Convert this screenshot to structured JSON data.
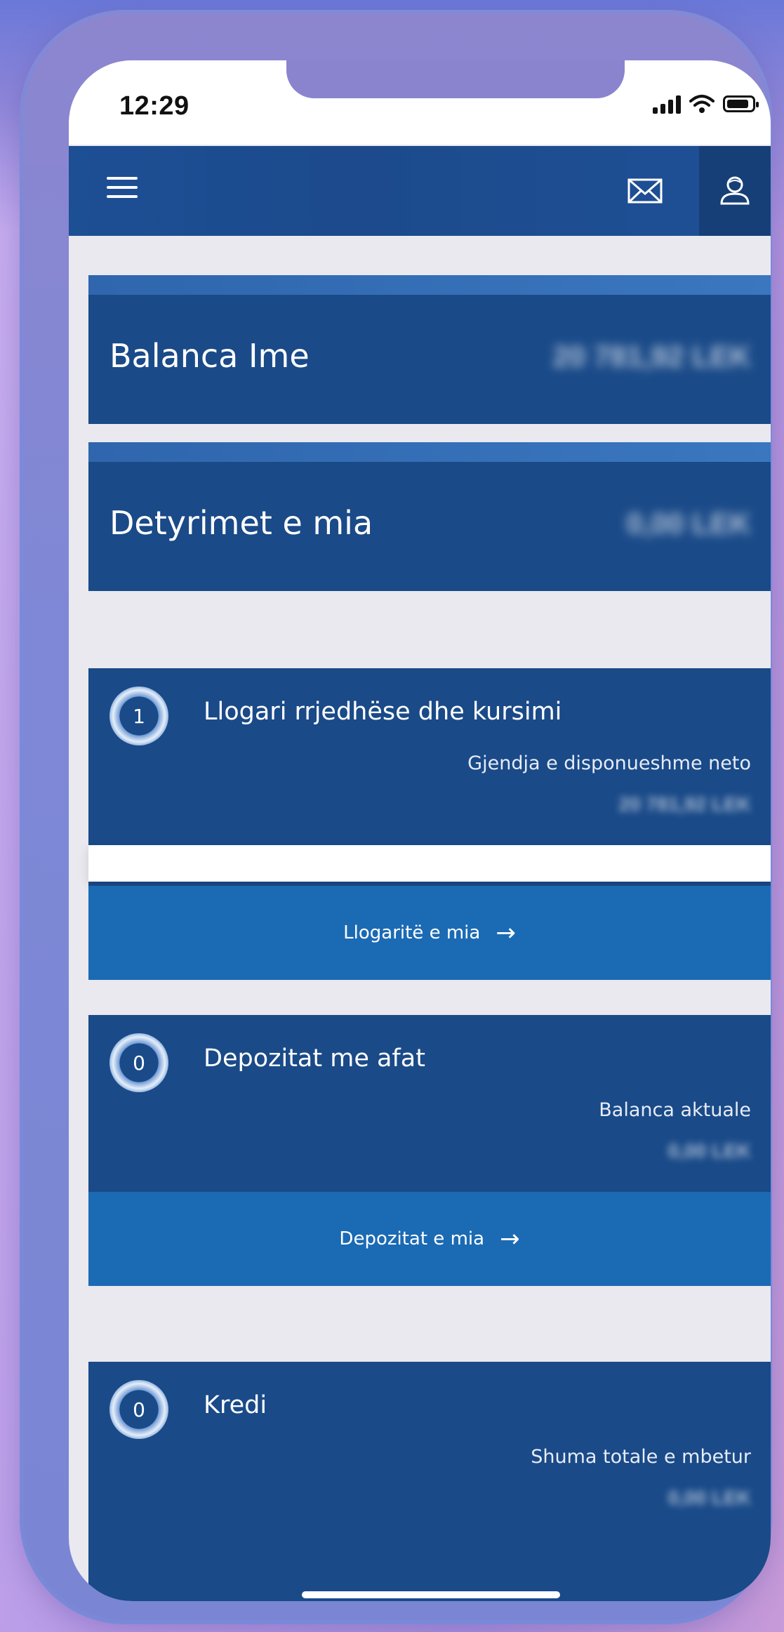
{
  "status_bar": {
    "time": "12:29"
  },
  "navbar": {
    "icons": [
      "menu-icon",
      "mail-icon",
      "user-icon"
    ]
  },
  "summary": {
    "balance": {
      "label": "Balanca Ime",
      "amount": "20 781,92 LEK"
    },
    "obligations": {
      "label": "Detyrimet e mia",
      "amount": "0,00 LEK"
    }
  },
  "accounts": [
    {
      "count": "1",
      "title": "Llogari rrjedhëse dhe kursimi",
      "subtitle": "Gjendja e disponueshme neto",
      "value": "20 781,92 LEK",
      "link": "Llogaritë e mia",
      "arrow": "→"
    },
    {
      "count": "0",
      "title": "Depozitat me afat",
      "subtitle": "Balanca aktuale",
      "value": "0,00 LEK",
      "link": "Depozitat e mia",
      "arrow": "→"
    },
    {
      "count": "0",
      "title": "Kredi",
      "subtitle": "Shuma totale e mbetur",
      "value": "0,00 LEK"
    }
  ],
  "colors": {
    "navy": "#1a4a88",
    "button_blue": "#1b6ab4",
    "background": "#e9e9ef"
  }
}
